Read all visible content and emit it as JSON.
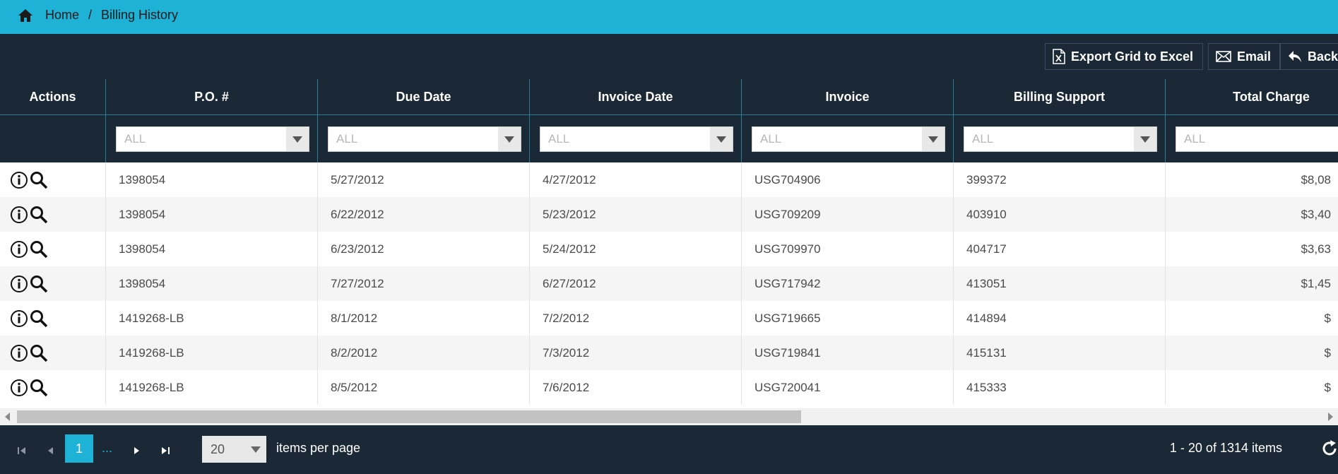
{
  "breadcrumb": {
    "home": "Home",
    "separator": "/",
    "current": "Billing History"
  },
  "toolbar": {
    "export_label": "Export Grid to Excel",
    "email_label": "Email",
    "back_label": "Back"
  },
  "grid": {
    "columns": [
      "Actions",
      "P.O. #",
      "Due Date",
      "Invoice Date",
      "Invoice",
      "Billing Support",
      "Total Charge"
    ],
    "filter_placeholder": "ALL",
    "rows": [
      {
        "po": "1398054",
        "due": "5/27/2012",
        "inv_date": "4/27/2012",
        "invoice": "USG704906",
        "support": "399372",
        "total": "$8,08"
      },
      {
        "po": "1398054",
        "due": "6/22/2012",
        "inv_date": "5/23/2012",
        "invoice": "USG709209",
        "support": "403910",
        "total": "$3,40"
      },
      {
        "po": "1398054",
        "due": "6/23/2012",
        "inv_date": "5/24/2012",
        "invoice": "USG709970",
        "support": "404717",
        "total": "$3,63"
      },
      {
        "po": "1398054",
        "due": "7/27/2012",
        "inv_date": "6/27/2012",
        "invoice": "USG717942",
        "support": "413051",
        "total": "$1,45"
      },
      {
        "po": "1419268-LB",
        "due": "8/1/2012",
        "inv_date": "7/2/2012",
        "invoice": "USG719665",
        "support": "414894",
        "total": "$"
      },
      {
        "po": "1419268-LB",
        "due": "8/2/2012",
        "inv_date": "7/3/2012",
        "invoice": "USG719841",
        "support": "415131",
        "total": "$"
      },
      {
        "po": "1419268-LB",
        "due": "8/5/2012",
        "inv_date": "7/6/2012",
        "invoice": "USG720041",
        "support": "415333",
        "total": "$"
      }
    ]
  },
  "pager": {
    "current_page": "1",
    "more": "...",
    "page_size": "20",
    "per_page_label": "items per page",
    "info": "1 - 20 of 1314 items"
  },
  "colors": {
    "accent": "#1eb2d6",
    "dark": "#1b2835"
  },
  "icons": [
    "home-icon",
    "excel-icon",
    "mail-icon",
    "back-arrow-icon",
    "info-icon",
    "search-icon",
    "first-page-icon",
    "prev-page-icon",
    "next-page-icon",
    "last-page-icon",
    "refresh-icon"
  ]
}
